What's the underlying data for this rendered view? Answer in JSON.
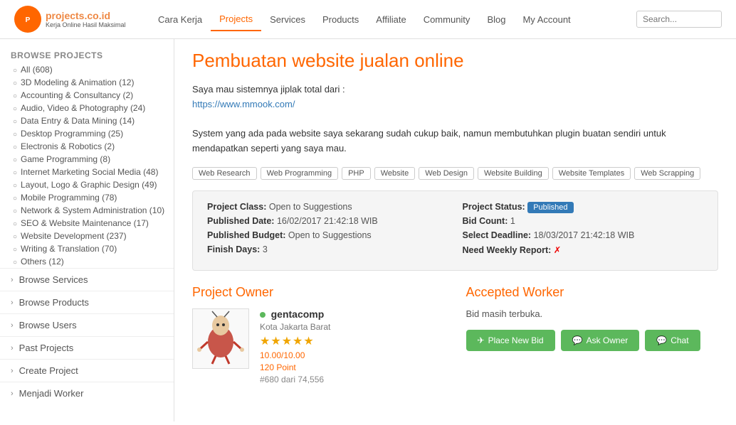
{
  "header": {
    "logo_text": "projects.co.id",
    "logo_sub": "Kerja Online Hasil Maksimal",
    "nav_items": [
      {
        "label": "Cara Kerja",
        "href": "#",
        "active": false
      },
      {
        "label": "Projects",
        "href": "#",
        "active": true
      },
      {
        "label": "Services",
        "href": "#",
        "active": false
      },
      {
        "label": "Products",
        "href": "#",
        "active": false
      },
      {
        "label": "Affiliate",
        "href": "#",
        "active": false
      },
      {
        "label": "Community",
        "href": "#",
        "active": false
      },
      {
        "label": "Blog",
        "href": "#",
        "active": false
      },
      {
        "label": "My Account",
        "href": "#",
        "active": false
      }
    ],
    "search_placeholder": "Search..."
  },
  "sidebar": {
    "browse_categories_label": "Browse Projects",
    "categories": [
      {
        "label": "All (608)"
      },
      {
        "label": "3D Modeling & Animation (12)"
      },
      {
        "label": "Accounting & Consultancy (2)"
      },
      {
        "label": "Audio, Video & Photography (24)"
      },
      {
        "label": "Data Entry & Data Mining (14)"
      },
      {
        "label": "Desktop Programming (25)"
      },
      {
        "label": "Electronis & Robotics (2)"
      },
      {
        "label": "Game Programming (8)"
      },
      {
        "label": "Internet Marketing Social Media (48)"
      },
      {
        "label": "Layout, Logo & Graphic Design (49)"
      },
      {
        "label": "Mobile Programming (78)"
      },
      {
        "label": "Network & System Administration (10)"
      },
      {
        "label": "SEO & Website Maintenance (17)"
      },
      {
        "label": "Website Development (237)"
      },
      {
        "label": "Writing & Translation (70)"
      },
      {
        "label": "Others (12)"
      }
    ],
    "links": [
      {
        "label": "Browse Services"
      },
      {
        "label": "Browse Products"
      },
      {
        "label": "Browse Users"
      },
      {
        "label": "Past Projects"
      },
      {
        "label": "Create Project"
      },
      {
        "label": "Menjadi Worker"
      }
    ]
  },
  "project": {
    "title": "Pembuatan website jualan online",
    "description_line1": "Saya mau sistemnya jiplak total dari :",
    "description_link": "https://www.mmook.com/",
    "description_line2": "System yang ada pada website saya sekarang sudah cukup baik, namun membutuhkan plugin buatan sendiri untuk mendapatkan seperti yang saya mau.",
    "tags": [
      "Web Research",
      "Web Programming",
      "PHP",
      "Website",
      "Web Design",
      "Website Building",
      "Website Templates",
      "Web Scrapping"
    ],
    "meta": {
      "class_label": "Project Class:",
      "class_value": "Open to Suggestions",
      "published_date_label": "Published Date:",
      "published_date_value": "16/02/2017 21:42:18 WIB",
      "published_budget_label": "Published Budget:",
      "published_budget_value": "Open to Suggestions",
      "finish_days_label": "Finish Days:",
      "finish_days_value": "3",
      "status_label": "Project Status:",
      "status_value": "Published",
      "bid_count_label": "Bid Count:",
      "bid_count_value": "1",
      "select_deadline_label": "Select Deadline:",
      "select_deadline_value": "18/03/2017 21:42:18 WIB",
      "weekly_report_label": "Need Weekly Report:",
      "weekly_report_value": "✗"
    }
  },
  "owner": {
    "section_title": "Project Owner",
    "username": "gentacomp",
    "city": "Kota Jakarta Barat",
    "stars": "★★★★★",
    "rating": "10.00/10.00",
    "points": "120 Point",
    "rank": "#680 dari 74,556"
  },
  "accepted_worker": {
    "section_title": "Accepted Worker",
    "bid_status": "Bid masih terbuka.",
    "btn_place_bid": "Place New Bid",
    "btn_ask_owner": "Ask Owner",
    "btn_chat": "Chat"
  }
}
